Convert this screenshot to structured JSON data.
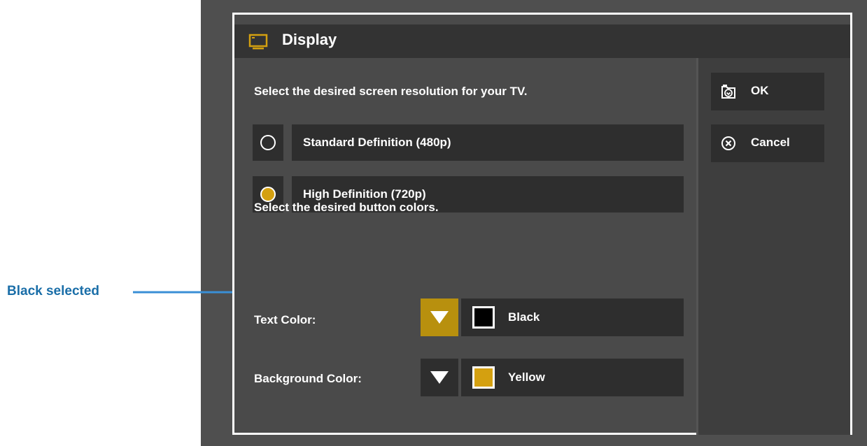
{
  "dialog": {
    "title": "Display",
    "title_icon": "tv-icon"
  },
  "resolution": {
    "prompt": "Select the desired screen resolution for your TV.",
    "options": [
      {
        "label": "Standard Definition (480p)",
        "selected": false
      },
      {
        "label": "High Definition (720p)",
        "selected": true
      }
    ]
  },
  "button_colors": {
    "prompt": "Select the desired button colors.",
    "text_color": {
      "label": "Text Color:",
      "value": "Black",
      "swatch": "#000000",
      "dropdown_active": true
    },
    "background_color": {
      "label": "Background Color:",
      "value": "Yellow",
      "swatch": "#d4a010",
      "dropdown_active": false
    }
  },
  "actions": {
    "ok_label": "OK",
    "ok_icon": "save-icon",
    "cancel_label": "Cancel",
    "cancel_icon": "cancel-circle-icon"
  },
  "annotation": {
    "label": "Black selected",
    "color": "#1a6ea8",
    "arrow_color": "#3a8fd6"
  },
  "colors": {
    "accent": "#d4a010",
    "panel": "#4a4a4a",
    "tile": "#2e2e2e",
    "titlebar": "#333333"
  }
}
